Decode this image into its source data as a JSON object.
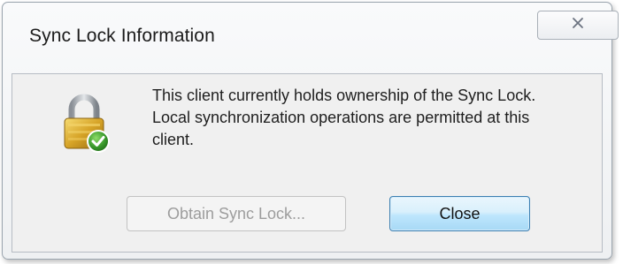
{
  "window": {
    "title": "Sync Lock Information"
  },
  "message": {
    "text": "This client currently holds ownership of the Sync Lock. Local synchronization operations are permitted at this client."
  },
  "buttons": {
    "obtain_label": "Obtain Sync Lock...",
    "obtain_enabled": false,
    "close_label": "Close",
    "close_default": true
  },
  "icons": {
    "status_icon": "padlock-with-checkmark-icon",
    "title_close": "close-icon"
  },
  "colors": {
    "close_button_border": "#3c7fb1",
    "disabled_text": "#9d9d9d",
    "checkmark_badge": "#3a9a2c",
    "lock_gold": "#d6a327"
  }
}
